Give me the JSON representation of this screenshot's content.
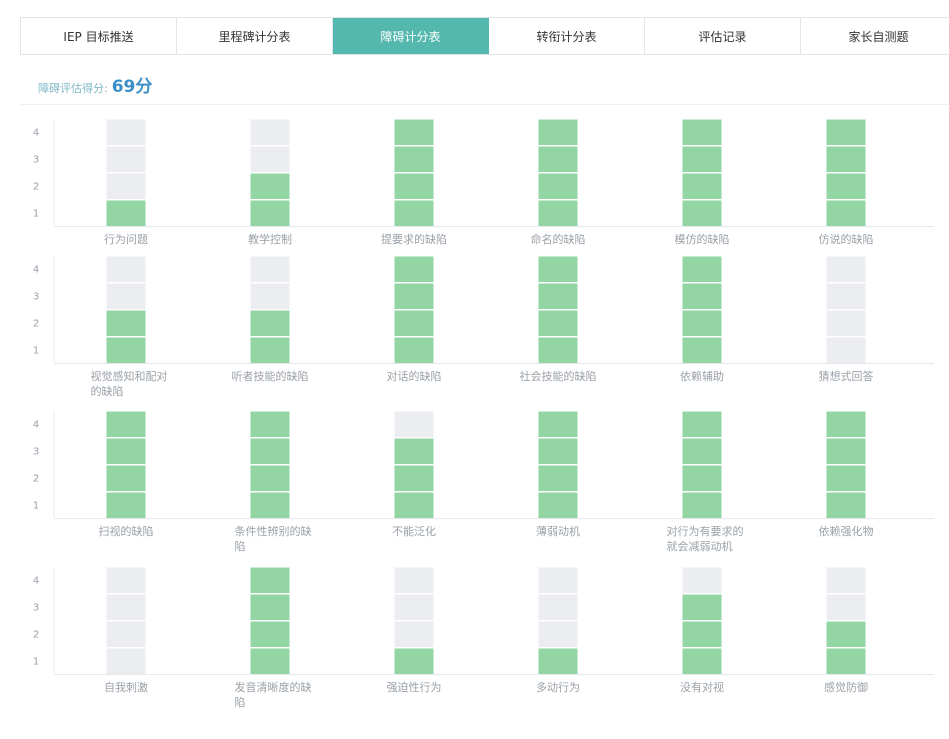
{
  "tabs": [
    {
      "label": "IEP 目标推送",
      "active": false
    },
    {
      "label": "里程碑计分表",
      "active": false
    },
    {
      "label": "障碍计分表",
      "active": true
    },
    {
      "label": "转衔计分表",
      "active": false
    },
    {
      "label": "评估记录",
      "active": false
    },
    {
      "label": "家长自测题",
      "active": false
    }
  ],
  "score": {
    "label": "障碍评估得分:",
    "value": "69分"
  },
  "colors": {
    "accent": "#55b8ae",
    "filled": "#93d6a4",
    "empty": "#ebedf0"
  },
  "chart_data": [
    {
      "type": "bar",
      "ylim": [
        0,
        4
      ],
      "yticks": [
        "1",
        "2",
        "3",
        "4"
      ],
      "categories": [
        "行为问题",
        "教学控制",
        "提要求的缺陷",
        "命名的缺陷",
        "模仿的缺陷",
        "仿说的缺陷"
      ],
      "values": [
        1,
        2,
        4,
        4,
        4,
        4
      ]
    },
    {
      "type": "bar",
      "ylim": [
        0,
        4
      ],
      "yticks": [
        "1",
        "2",
        "3",
        "4"
      ],
      "categories": [
        "视觉感知和配对的缺陷",
        "听者技能的缺陷",
        "对话的缺陷",
        "社会技能的缺陷",
        "依赖辅助",
        "猜想式回答"
      ],
      "values": [
        2,
        2,
        4,
        4,
        4,
        0
      ]
    },
    {
      "type": "bar",
      "ylim": [
        0,
        4
      ],
      "yticks": [
        "1",
        "2",
        "3",
        "4"
      ],
      "categories": [
        "扫视的缺陷",
        "条件性辨别的缺陷",
        "不能泛化",
        "薄弱动机",
        "对行为有要求的就会减弱动机",
        "依赖强化物"
      ],
      "values": [
        4,
        4,
        3,
        4,
        4,
        4
      ]
    },
    {
      "type": "bar",
      "ylim": [
        0,
        4
      ],
      "yticks": [
        "1",
        "2",
        "3",
        "4"
      ],
      "categories": [
        "自我刺激",
        "发音清晰度的缺陷",
        "强迫性行为",
        "多动行为",
        "没有对视",
        "感觉防御"
      ],
      "values": [
        0,
        4,
        1,
        1,
        3,
        2
      ]
    }
  ]
}
